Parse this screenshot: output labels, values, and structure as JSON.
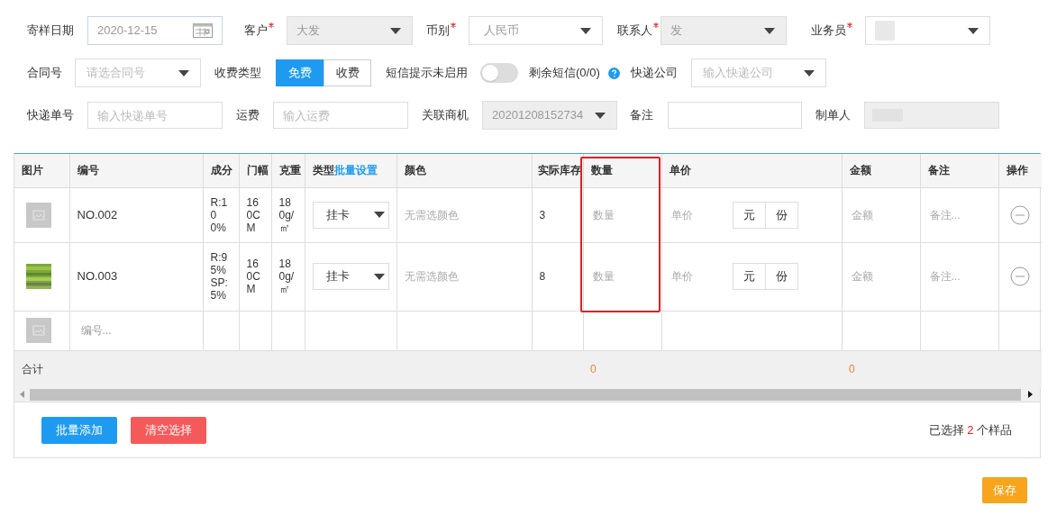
{
  "form": {
    "fields": [
      {
        "kind": "date",
        "label": "寄样日期",
        "required": false,
        "value": "2020-12-15"
      },
      {
        "kind": "select",
        "label": "客户",
        "required": true,
        "value": "大发",
        "disabled": true
      },
      {
        "kind": "select",
        "label": "币别",
        "required": true,
        "value": "人民币",
        "disabled": false
      },
      {
        "kind": "select",
        "label": "联系人",
        "required": true,
        "value": "发",
        "disabled": true
      },
      {
        "kind": "select",
        "label": "业务员",
        "required": true,
        "redacted": true,
        "disabled": false
      },
      {
        "kind": "select",
        "label": "合同号",
        "required": false,
        "placeholder": "请选合同号",
        "disabled": false
      },
      {
        "kind": "segmented",
        "label": "收费类型",
        "options": [
          {
            "label": "免费",
            "selected": true
          },
          {
            "label": "收费",
            "selected": false
          }
        ]
      },
      {
        "kind": "switch",
        "label": "短信提示未启用",
        "on": false
      },
      {
        "kind": "note",
        "label": "剩余短信(0/0)"
      },
      {
        "kind": "select",
        "label": "快递公司",
        "required": false,
        "placeholder": "输入快递公司",
        "disabled": false
      },
      {
        "kind": "input",
        "label": "快递单号",
        "placeholder": "输入快递单号",
        "disabled": false
      },
      {
        "kind": "input",
        "label": "运费",
        "placeholder": "输入运费",
        "disabled": false
      },
      {
        "kind": "select",
        "label": "关联商机",
        "required": false,
        "value": "20201208152734",
        "disabled": true
      },
      {
        "kind": "input",
        "label": "备注",
        "disabled": false
      },
      {
        "kind": "input",
        "label": "制单人",
        "redacted": true,
        "disabled": true
      }
    ]
  },
  "table": {
    "columns": [
      {
        "label": "图片"
      },
      {
        "label": "编号"
      },
      {
        "label": "成分"
      },
      {
        "label": "门幅"
      },
      {
        "label": "克重"
      },
      {
        "label": "类型",
        "link": "批量设置"
      },
      {
        "label": "颜色"
      },
      {
        "label": "实际库存"
      },
      {
        "label": "数量",
        "highlighted": true
      },
      {
        "label": "单价"
      },
      {
        "label": "金额"
      },
      {
        "label": "备注"
      },
      {
        "label": "操作"
      }
    ],
    "rows": [
      {
        "thumbnail": {
          "kind": "placeholder"
        },
        "code": "NO.002",
        "composition": "R:100%",
        "width": "160CM",
        "weight": "180g/㎡",
        "type": "挂卡",
        "color_text": "无需选颜色",
        "stock": "3",
        "quantity_placeholder": "数量",
        "price_placeholder": "单价",
        "units": [
          "元",
          "份"
        ],
        "amount_placeholder": "金额",
        "note_placeholder": "备注..."
      },
      {
        "code": "NO.003",
        "composition": "R:95% SP:5%",
        "width": "160CM",
        "weight": "180g/㎡",
        "type": "挂卡",
        "color_text": "无需选颜色",
        "stock": "8",
        "quantity_placeholder": "数量",
        "price_placeholder": "单价",
        "units": [
          "元",
          "份"
        ],
        "amount_placeholder": "金额",
        "note_placeholder": "备注..."
      }
    ],
    "new_row": {
      "thumbnail": {
        "kind": "placeholder"
      },
      "code_placeholder": "编号..."
    },
    "totals": {
      "label": "合计",
      "quantity": "0",
      "amount": "0"
    }
  },
  "footer": {
    "buttons": [
      "批量添加",
      "清空选择"
    ],
    "summary": {
      "prefix": "已选择",
      "count": "2",
      "suffix": "个样品"
    }
  },
  "save_button": "保存"
}
